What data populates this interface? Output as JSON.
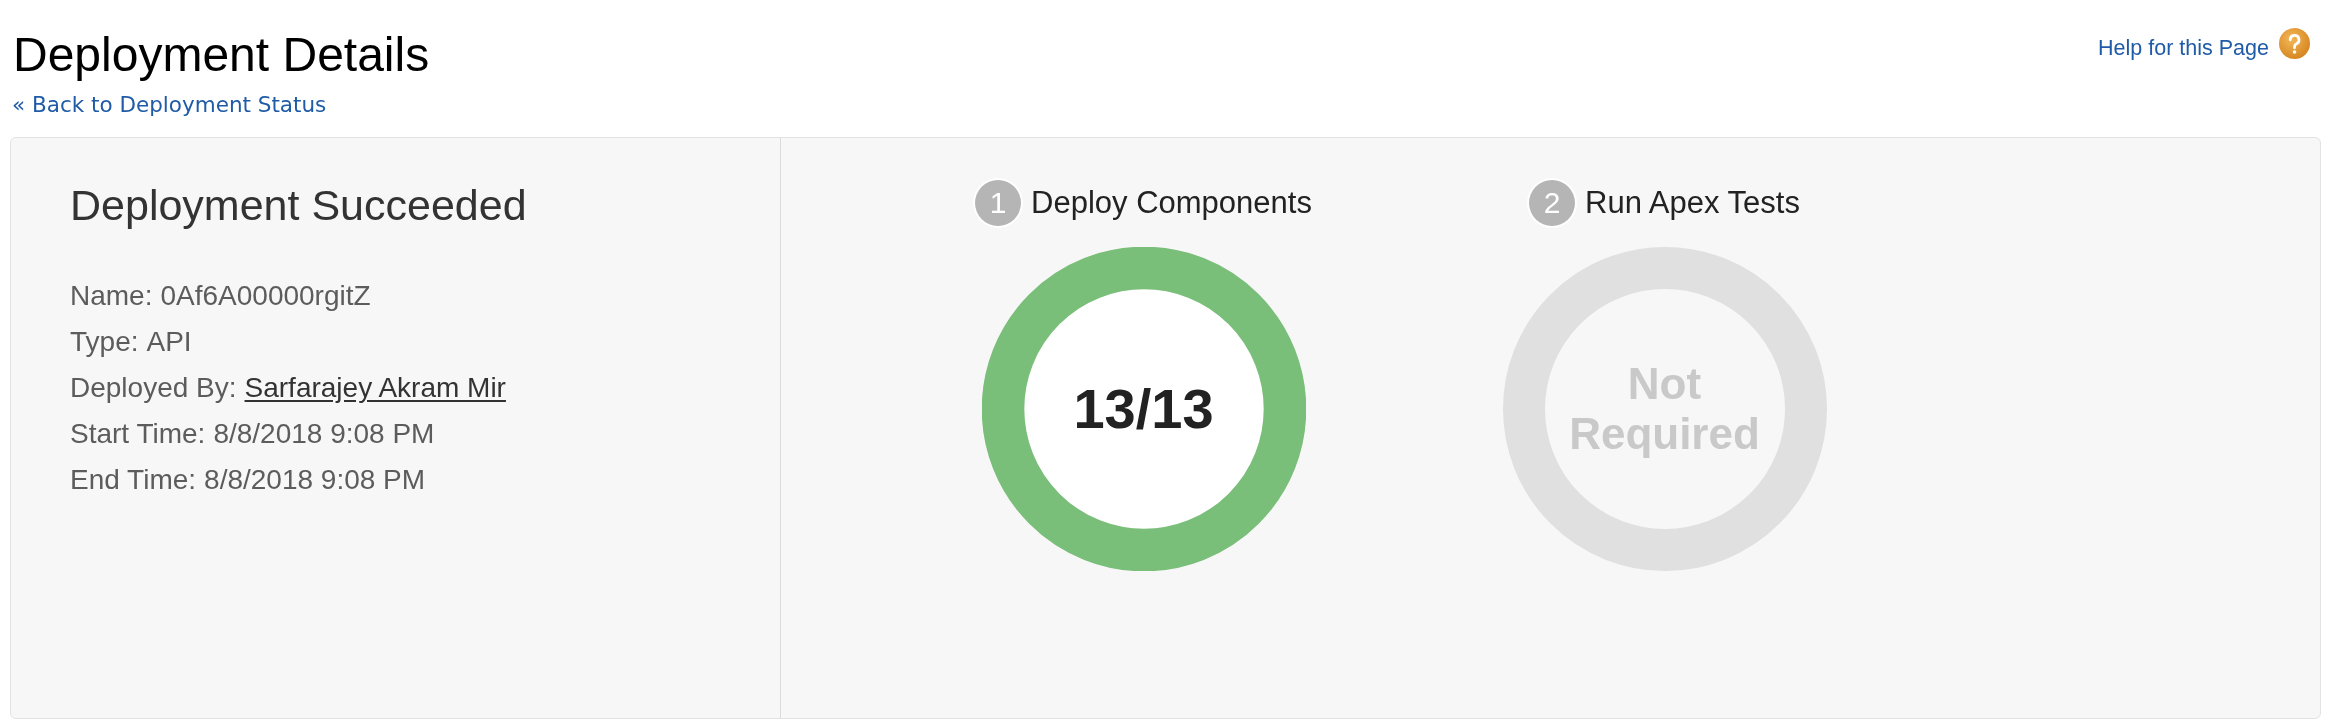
{
  "page": {
    "title": "Deployment Details",
    "back_link": "« Back to Deployment Status",
    "help_link": "Help for this Page"
  },
  "summary": {
    "heading": "Deployment Succeeded",
    "details": [
      {
        "label": "Name:",
        "value": "0Af6A00000rgitZ",
        "kind": "text"
      },
      {
        "label": "Type:",
        "value": "API",
        "kind": "text"
      },
      {
        "label": "Deployed By:",
        "value": "Sarfarajey Akram Mir",
        "kind": "link"
      },
      {
        "label": "Start Time:",
        "value": "8/8/2018 9:08 PM",
        "kind": "text"
      },
      {
        "label": "End Time:",
        "value": "8/8/2018 9:08 PM",
        "kind": "text"
      }
    ]
  },
  "steps": [
    {
      "number": "1",
      "title": "Deploy Components",
      "kind": "count",
      "level": 1,
      "reading": "13/13"
    },
    {
      "number": "2",
      "title": "Run Apex Tests",
      "kind": "status",
      "reading": "Not Required"
    }
  ]
}
